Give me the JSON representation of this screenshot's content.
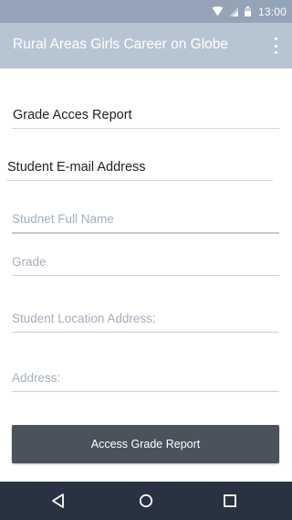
{
  "status_bar": {
    "time": "13:00",
    "icons": [
      "wifi-icon",
      "signal-icon",
      "battery-icon"
    ]
  },
  "app_bar": {
    "title": "Rural Areas Girls Career on Globe",
    "overflow_icon": "more-vert-icon"
  },
  "form": {
    "report_title_value": "Grade Acces Report",
    "email_value": "Student E-mail Address",
    "full_name_placeholder": "Studnet Full Name",
    "grade_placeholder": "Grade",
    "location_placeholder": "Student Location Address:",
    "address_placeholder": "Address:",
    "submit_label": "Access Grade Report"
  },
  "nav_bar": {
    "icons": [
      "back-icon",
      "home-icon",
      "recents-icon"
    ]
  },
  "colors": {
    "status_bar": "#94a3b5",
    "app_bar": "#b7c5d3",
    "button": "#4a525b",
    "nav_bar": "#283241",
    "hint_text": "#a4afbb"
  }
}
